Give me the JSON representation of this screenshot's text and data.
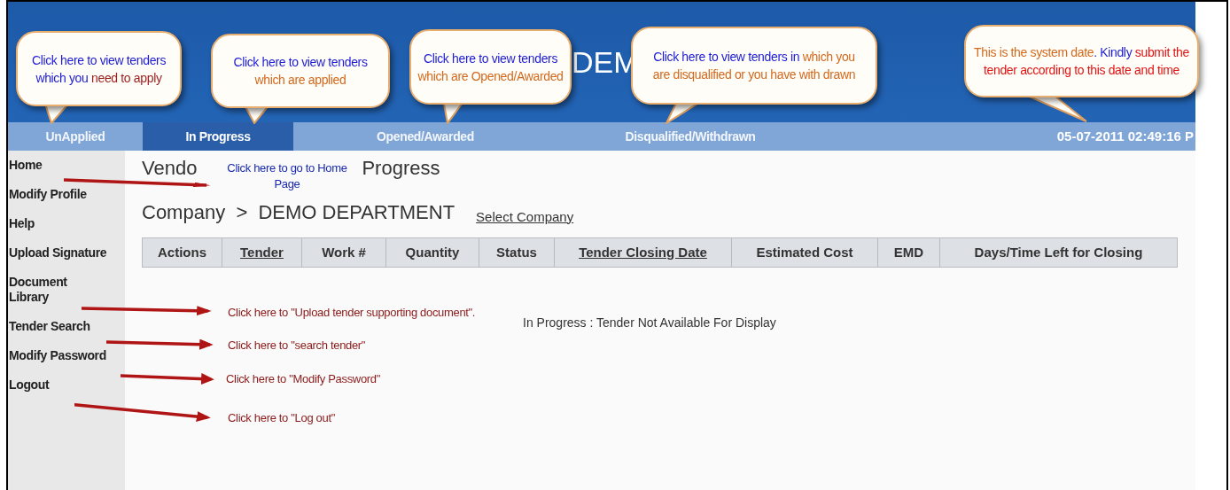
{
  "header": {
    "title": "DEM"
  },
  "tabs": [
    {
      "label": "UnApplied",
      "selected": false
    },
    {
      "label": "In Progress",
      "selected": true
    },
    {
      "label": "Opened/Awarded",
      "selected": false
    },
    {
      "label": "Disqualified/Withdrawn",
      "selected": false
    }
  ],
  "system_date": "05-07-2011 02:49:16 P",
  "sidebar": {
    "items": [
      {
        "label": "Home"
      },
      {
        "label": "Modify Profile"
      },
      {
        "label": "Help"
      },
      {
        "label": "Upload Signature"
      },
      {
        "label": "Document Library"
      },
      {
        "label": "Tender Search"
      },
      {
        "label": "Modify Password"
      },
      {
        "label": "Logout"
      }
    ]
  },
  "page_heading": {
    "left": "Vendo",
    "right": "Progress"
  },
  "breadcrumb": {
    "text": "Company  >  DEMO DEPARTMENT",
    "link": "Select Company"
  },
  "table": {
    "columns": [
      {
        "label": "Actions",
        "sortable": false
      },
      {
        "label": "Tender",
        "sortable": true
      },
      {
        "label": "Work #",
        "sortable": false
      },
      {
        "label": "Quantity",
        "sortable": false
      },
      {
        "label": "Status",
        "sortable": false
      },
      {
        "label": "Tender Closing Date",
        "sortable": true
      },
      {
        "label": "Estimated Cost",
        "sortable": false
      },
      {
        "label": "EMD",
        "sortable": false
      },
      {
        "label": "Days/Time Left for Closing",
        "sortable": false
      }
    ]
  },
  "empty_message": "In Progress : Tender Not Available For Display",
  "callouts": [
    {
      "lines": [
        [
          {
            "text": "Click here to view tenders",
            "color": "#1c1cd6"
          }
        ],
        [
          {
            "text": "which you ",
            "color": "#1c1cd6"
          },
          {
            "text": "need to apply",
            "color": "#9b1c1c"
          }
        ]
      ]
    },
    {
      "lines": [
        [
          {
            "text": "Click here to view tenders",
            "color": "#1c1cd6"
          }
        ],
        [
          {
            "text": "which are applied",
            "color": "#d2691e"
          }
        ]
      ]
    },
    {
      "lines": [
        [
          {
            "text": "Click here to view tenders",
            "color": "#1c1cd6"
          }
        ],
        [
          {
            "text": "which are Opened/Awarded",
            "color": "#d2691e"
          }
        ]
      ]
    },
    {
      "lines": [
        [
          {
            "text": "Click here to view tenders in ",
            "color": "#1c1cd6"
          },
          {
            "text": "which you",
            "color": "#d2691e"
          }
        ],
        [
          {
            "text": "are disqualified or you have with drawn",
            "color": "#d2691e"
          }
        ]
      ]
    },
    {
      "lines": [
        [
          {
            "text": "This is the system date",
            "color": "#d2691e"
          },
          {
            "text": ". Kindly",
            "color": "#1c1cd6"
          },
          {
            "text": " submit the",
            "color": "#e01414"
          }
        ],
        [
          {
            "text": "tender according to this date and time",
            "color": "#e01414"
          }
        ]
      ]
    }
  ],
  "arrow_notes": [
    {
      "lines": [
        "Click here to go to Home",
        "Page"
      ],
      "color": "#1a2ab0"
    },
    {
      "lines": [
        "Click here to \"Upload tender supporting document\"."
      ],
      "color": "#8b1a1a"
    },
    {
      "lines": [
        "Click here to \"search tender\""
      ],
      "color": "#8b1a1a"
    },
    {
      "lines": [
        "Click here to \"Modify Password\""
      ],
      "color": "#8b1a1a"
    },
    {
      "lines": [
        "Click here to \"Log out\""
      ],
      "color": "#8b1a1a"
    }
  ]
}
